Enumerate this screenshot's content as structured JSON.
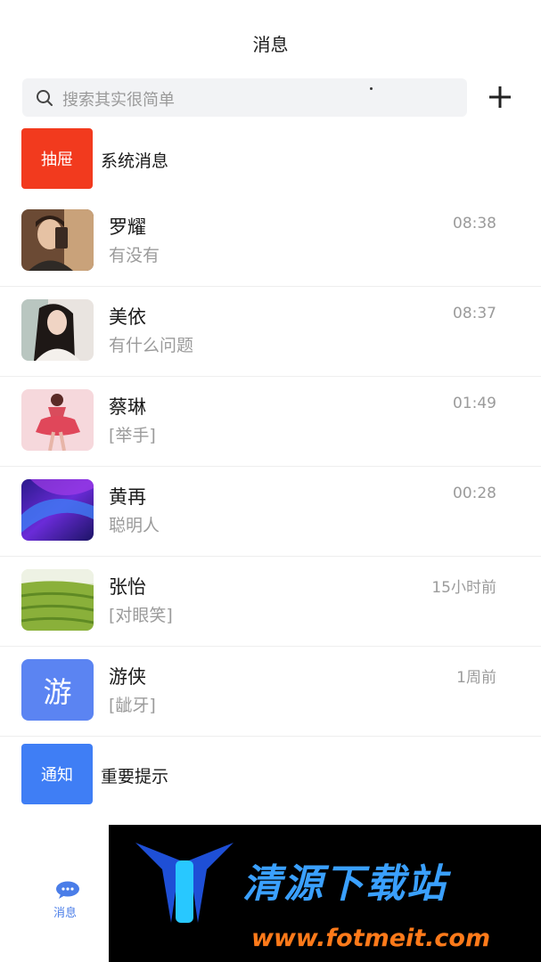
{
  "header": {
    "title": "消息"
  },
  "search": {
    "placeholder": "搜索其实很简单"
  },
  "special": [
    {
      "badge": "抽屉",
      "label": "系统消息",
      "color": "#f23a1e"
    },
    {
      "badge": "通知",
      "label": "重要提示",
      "color": "#3f7ef5"
    }
  ],
  "chats": [
    {
      "name": "罗耀",
      "message": "有没有",
      "time": "08:38"
    },
    {
      "name": "美依",
      "message": "有什么问题",
      "time": "08:37"
    },
    {
      "name": "蔡琳",
      "message": "[举手]",
      "time": "01:49"
    },
    {
      "name": "黄再",
      "message": "聪明人",
      "time": "00:28"
    },
    {
      "name": "张怡",
      "message": "[对眼笑]",
      "time": "15小时前"
    },
    {
      "name": "游侠",
      "message": "[龇牙]",
      "time": "1周前",
      "avatar_text": "游"
    }
  ],
  "tabbar": {
    "messages_label": "消息"
  },
  "watermark": {
    "title": "清源下载站",
    "url": "www.fotmeit.com"
  }
}
